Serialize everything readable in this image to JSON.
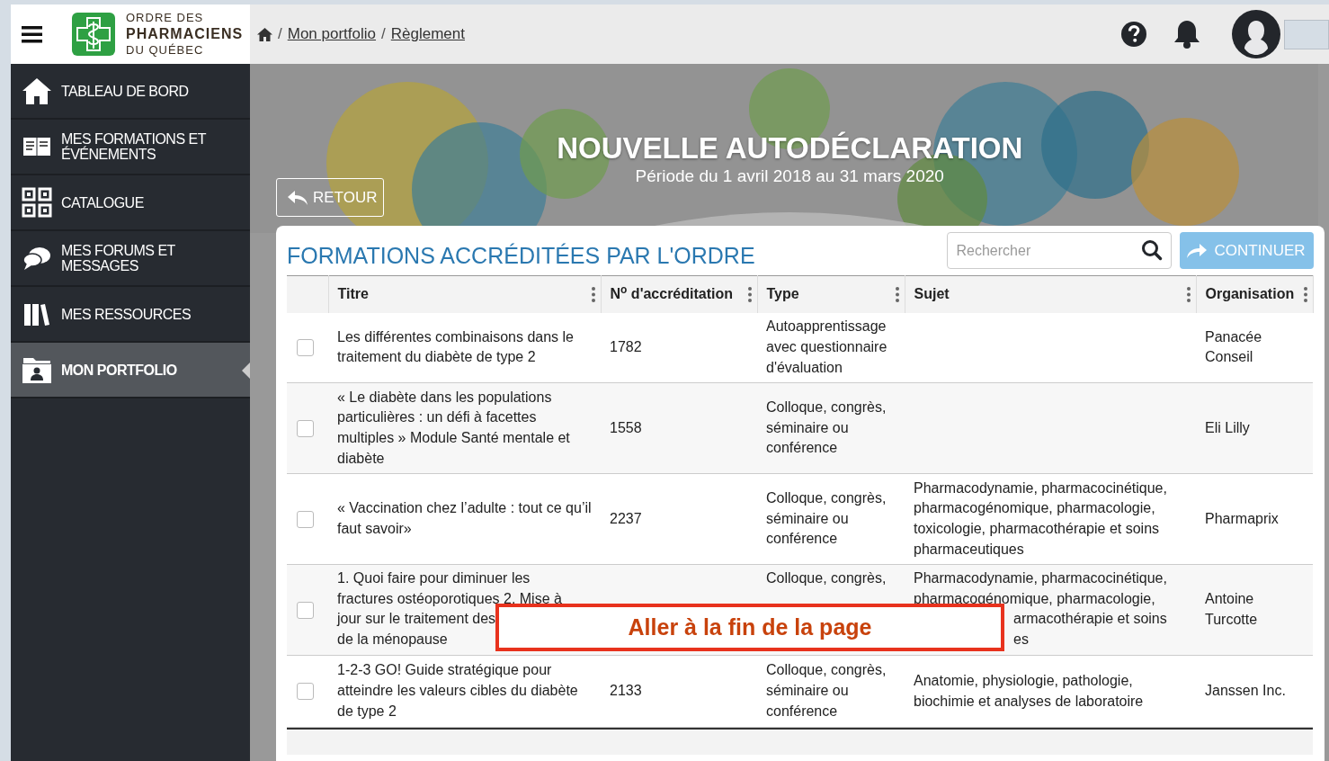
{
  "logo": {
    "lines": [
      "ORDRE DES",
      "PHARMACIENS",
      "DU QUÉBEC"
    ]
  },
  "breadcrumb": [
    {
      "kind": "separator",
      "text": "/"
    },
    {
      "kind": "link",
      "text": "Mon portfolio"
    },
    {
      "kind": "separator",
      "text": "/"
    },
    {
      "kind": "link",
      "text": "Règlement"
    }
  ],
  "sidebar": {
    "items": [
      {
        "label": "TABLEAU DE BORD",
        "selected": false
      },
      {
        "label": "MES FORMATIONS ET ÉVÉNEMENTS",
        "selected": false
      },
      {
        "label": "CATALOGUE",
        "selected": false
      },
      {
        "label": "MES FORUMS ET MESSAGES",
        "selected": false
      },
      {
        "label": "MES RESSOURCES",
        "selected": false
      },
      {
        "label": "MON PORTFOLIO",
        "selected": true
      }
    ]
  },
  "banner": {
    "title": "NOUVELLE AUTODÉCLARATION",
    "subtitle": "Période du 1 avril 2018 au 31 mars 2020",
    "back_button": "RETOUR"
  },
  "panel": {
    "title": "FORMATIONS ACCRÉDITÉES PAR L'ORDRE",
    "search": {
      "placeholder": "Rechercher"
    },
    "continue_button": "CONTINUER"
  },
  "table": {
    "columns": [
      "Titre",
      "N$^{o}$ d'accréditation",
      "Type",
      "Sujet",
      "Organisation"
    ],
    "rows": [
      {
        "checked": false,
        "cells": [
          "Les différentes combinaisons dans le traitement du diabète de type 2",
          "1782",
          "Autoapprentissage avec questionnaire d'évaluation",
          "",
          "Panacée Conseil"
        ]
      },
      {
        "checked": false,
        "cells": [
          "« Le diabète dans les populations particulières : un défi à facettes multiples » Module Santé mentale et diabète",
          "1558",
          "Colloque, congrès, séminaire ou conférence",
          "",
          "Eli Lilly"
        ]
      },
      {
        "checked": false,
        "cells": [
          "« Vaccination chez l’adulte : tout ce qu’il faut savoir»",
          "2237",
          "Colloque, congrès, séminaire ou conférence",
          "Pharmacodynamie, pharmacocinétique, pharmacogénomique, pharmacologie, toxicologie, pharmacothérapie et soins pharmaceutiques",
          "Pharmaprix"
        ]
      },
      {
        "checked": false,
        "cells": [
          [
            {
              "text": "1. Quoi faire pour diminuer les",
              "partial": false
            },
            {
              "text": "fractures ostéoporotiques 2. Mise à",
              "partial": false
            },
            {
              "text": "jour sur le traitement des",
              "partial": false
            },
            {
              "text": "de la ménopause",
              "partial": false
            }
          ],
          "",
          [
            {
              "text": "Colloque, congrès,",
              "partial": false
            }
          ],
          [
            {
              "text": "Pharmacodynamie, pharmacocinétique,",
              "partial": false
            },
            {
              "text": "pharmacogénomique, pharmacologie,",
              "partial": false
            },
            {
              "text": "armacothérapie et soins",
              "partial": true
            },
            {
              "text": "es",
              "partial": true
            }
          ],
          "Antoine Turcotte"
        ]
      },
      {
        "checked": false,
        "cells": [
          "1-2-3 GO! Guide stratégique pour atteindre les valeurs cibles du diabète de type 2",
          "2133",
          "Colloque, congrès, séminaire ou conférence",
          "Anatomie, physiologie, pathologie, biochimie et analyses de laboratoire",
          "Janssen Inc."
        ]
      }
    ]
  },
  "overlay": {
    "label": "Aller à la fin de la page"
  }
}
